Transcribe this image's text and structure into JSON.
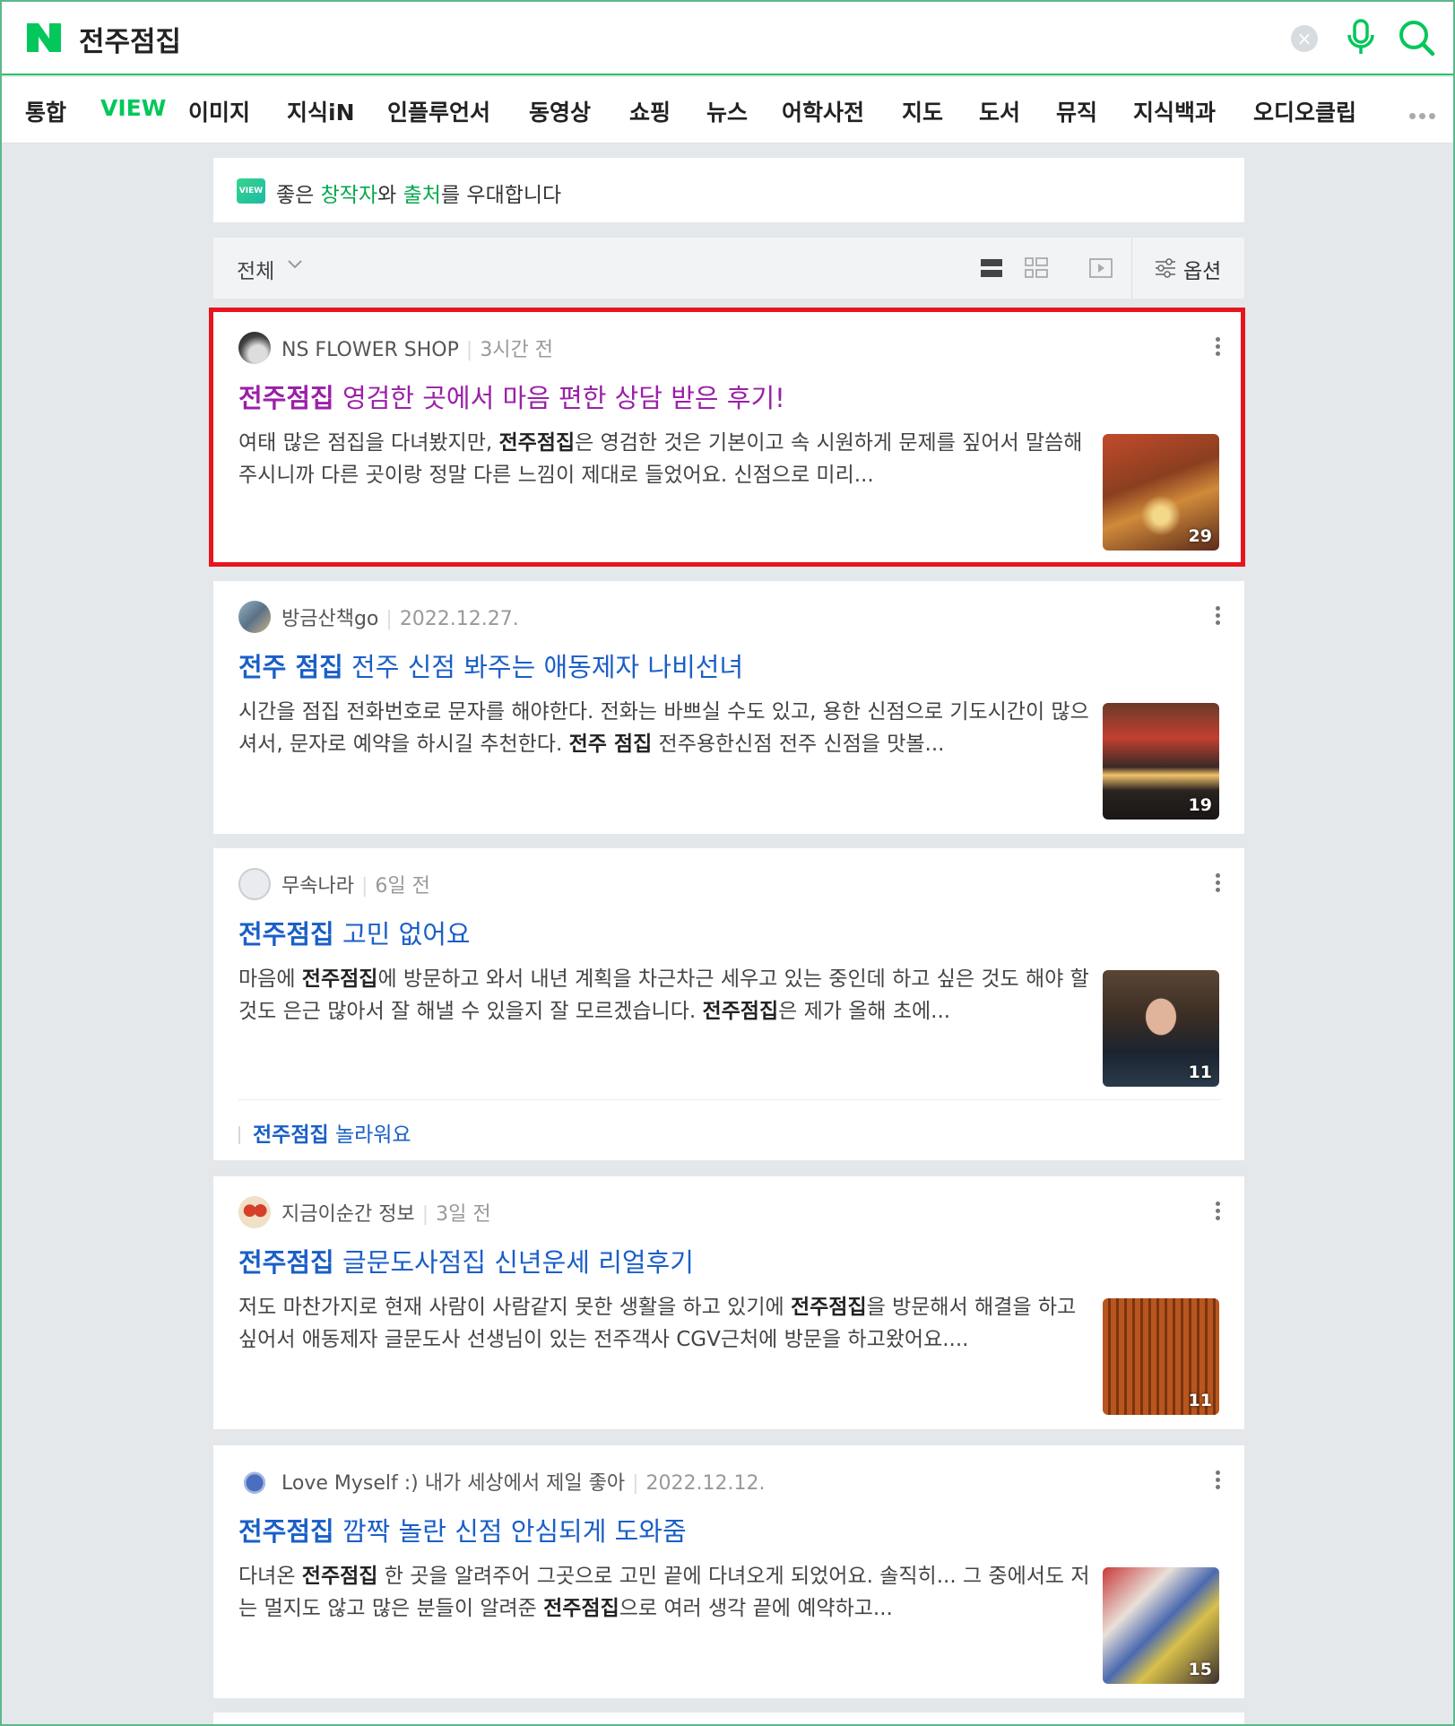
{
  "search": {
    "query": "전주점집"
  },
  "tabs": [
    "통합",
    "VIEW",
    "이미지",
    "지식iN",
    "인플루언서",
    "동영상",
    "쇼핑",
    "뉴스",
    "어학사전",
    "지도",
    "도서",
    "뮤직",
    "지식백과",
    "오디오클립"
  ],
  "banner": {
    "badge": "VIEW",
    "pre": "좋은 ",
    "creator": "창작자",
    "mid": "와 ",
    "source": "출처",
    "post": "를 우대합니다"
  },
  "filter": {
    "label": "전체",
    "options_label": "옵션"
  },
  "posts": [
    {
      "author": "NS FLOWER SHOP",
      "date": "3시간 전",
      "title_kw": "전주점집",
      "title_rest": " 영검한 곳에서 마음 편한 상담 받은 후기!",
      "desc_1": "여태 많은 점집을 다녀봤지만, ",
      "desc_b1": "전주점집",
      "desc_2": "은 영검한 것은 기본이고 속 시원하게 문제를 짚어서 말씀해주시니까 다른 곳이랑 정말 다른 느낌이 제대로 들었어요. 신점으로 미리...",
      "desc_b2": "",
      "desc_3": "",
      "count": "29"
    },
    {
      "author": "방금산책go",
      "date": "2022.12.27.",
      "title_kw": "전주 점집",
      "title_rest": " 전주 신점 봐주는 애동제자 나비선녀",
      "desc_1": "시간을 점집 전화번호로 문자를 해야한다. 전화는 바쁘실 수도 있고, 용한 신점으로 기도시간이 많으셔서, 문자로 예약을 하시길 추천한다. ",
      "desc_b1": "전주 점집",
      "desc_2": " 전주용한신점 전주 신점을 맛볼...",
      "desc_b2": "",
      "desc_3": "",
      "count": "19"
    },
    {
      "author": "무속나라",
      "date": "6일 전",
      "title_kw": "전주점집",
      "title_rest": " 고민 없어요",
      "desc_1": "마음에 ",
      "desc_b1": "전주점집",
      "desc_2": "에 방문하고 와서 내년 계획을 차근차근 세우고 있는 중인데 하고 싶은 것도 해야 할 것도 은근 많아서 잘 해낼 수 있을지 잘 모르겠습니다. ",
      "desc_b2": "전주점집",
      "desc_3": "은 제가 올해 초에...",
      "count": "11",
      "sub_kw": "전주점집",
      "sub_rest": " 놀라워요"
    },
    {
      "author": "지금이순간 정보",
      "date": "3일 전",
      "title_kw": "전주점집",
      "title_rest": " 글문도사점집 신년운세 리얼후기",
      "desc_1": "저도 마찬가지로 현재 사람이 사람같지 못한 생활을 하고 있기에 ",
      "desc_b1": "전주점집",
      "desc_2": "을 방문해서 해결을 하고 싶어서 애동제자 글문도사 선생님이 있는 전주객사 CGV근처에 방문을 하고왔어요....",
      "desc_b2": "",
      "desc_3": "",
      "count": "11"
    },
    {
      "author": "Love Myself :) 내가 세상에서 제일 좋아",
      "date": "2022.12.12.",
      "title_kw": "전주점집",
      "title_rest": " 깜짝 놀란 신점 안심되게 도와줌",
      "desc_1": "다녀온 ",
      "desc_b1": "전주점집",
      "desc_2": " 한 곳을 알려주어 그곳으로 고민 끝에 다녀오게 되었어요. 솔직히... 그 중에서도 저는 멀지도 않고 많은 분들이 알려준 ",
      "desc_b2": "전주점집",
      "desc_3": "으로 여러 생각 끝에 예약하고...",
      "count": "15"
    }
  ]
}
